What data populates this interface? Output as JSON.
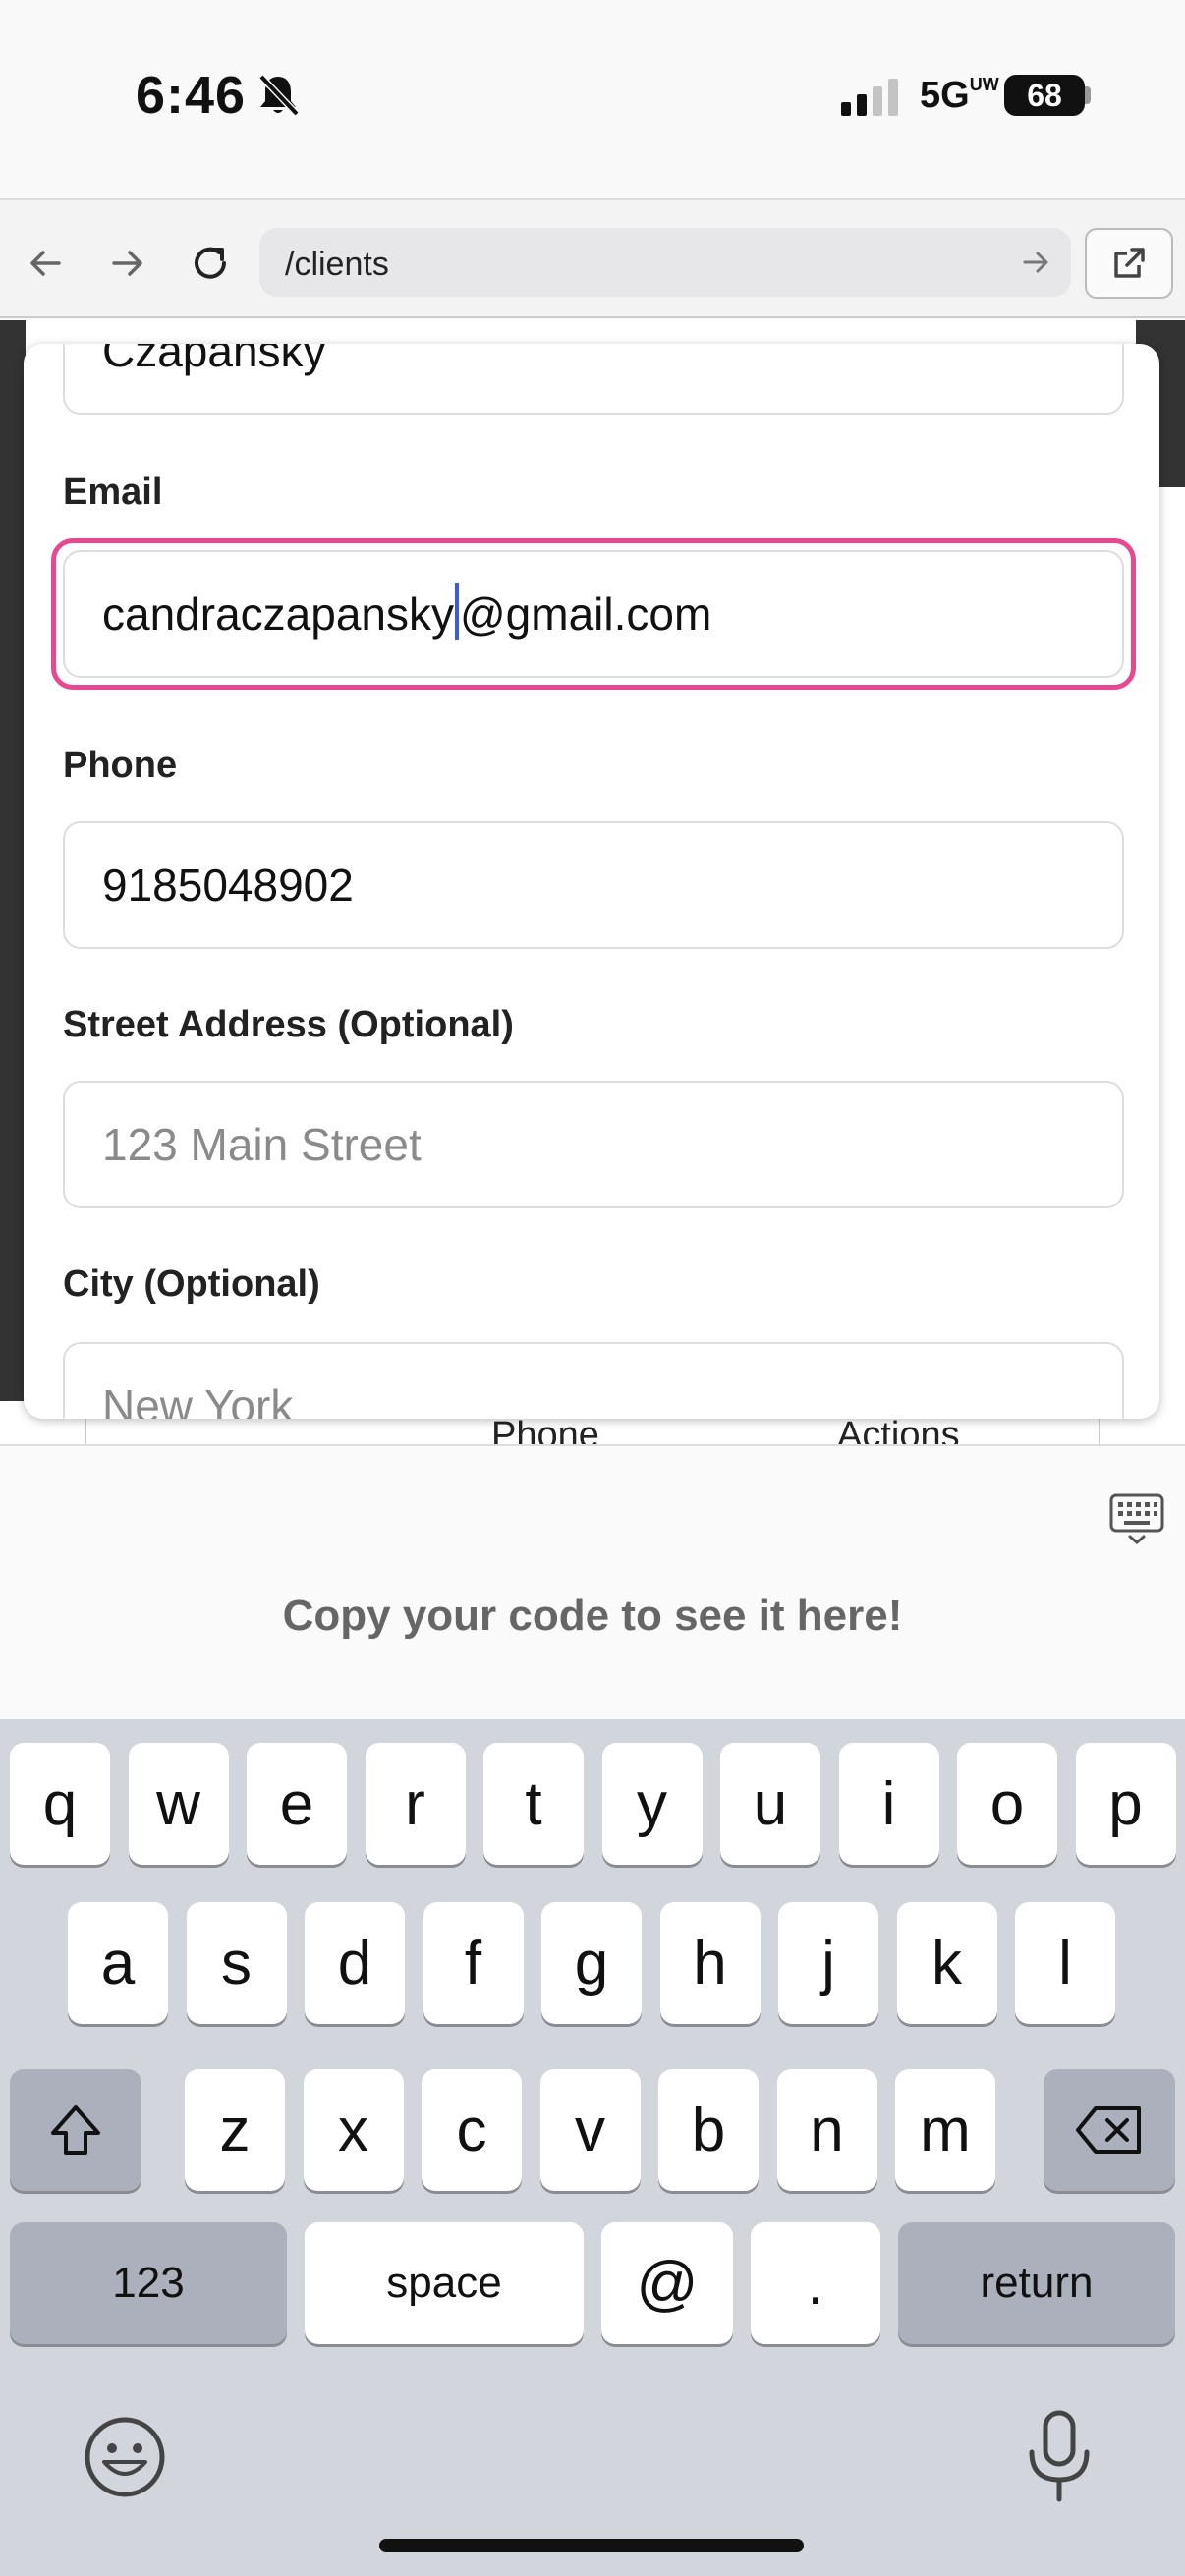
{
  "status_bar": {
    "time": "6:46",
    "network": "5G",
    "network_suffix": "UW",
    "battery": "68"
  },
  "browser": {
    "url": "/clients"
  },
  "table_headers": {
    "phone": "Phone",
    "actions": "Actions"
  },
  "form": {
    "last_name_value": "Czapansky",
    "email_label": "Email",
    "email_before_cursor": "candraczapansky",
    "email_after_cursor": "@gmail.com",
    "phone_label": "Phone",
    "phone_value": "9185048902",
    "street_label": "Street Address (Optional)",
    "street_placeholder": "123 Main Street",
    "city_label": "City (Optional)",
    "city_placeholder": "New York"
  },
  "preview": {
    "text": "Copy your code to see it here!"
  },
  "keyboard": {
    "row1": [
      "q",
      "w",
      "e",
      "r",
      "t",
      "y",
      "u",
      "i",
      "o",
      "p"
    ],
    "row2": [
      "a",
      "s",
      "d",
      "f",
      "g",
      "h",
      "j",
      "k",
      "l"
    ],
    "row3": [
      "z",
      "x",
      "c",
      "v",
      "b",
      "n",
      "m"
    ],
    "numbers_key": "123",
    "space_key": "space",
    "at_key": "@",
    "dot_key": ".",
    "return_key": "return"
  },
  "colors": {
    "focus_ring": "#e8488f",
    "caret": "#3b5bdb",
    "keyboard_bg": "#d3d5dc"
  }
}
